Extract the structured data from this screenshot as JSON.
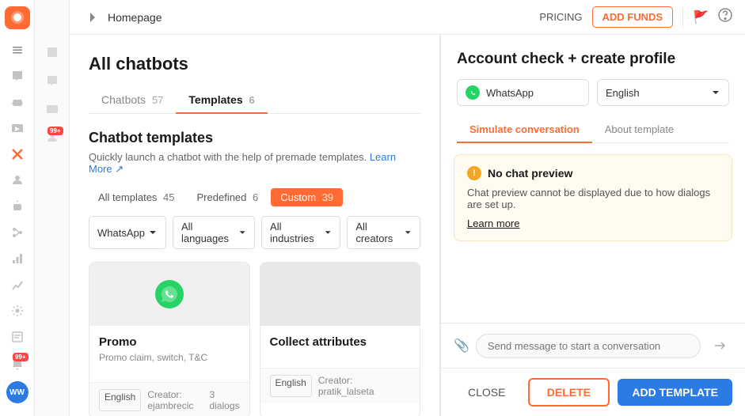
{
  "sidebar": {
    "logo": "🤖",
    "avatar": "WW",
    "items": [
      {
        "name": "home",
        "icon": "⊞",
        "active": false
      },
      {
        "name": "chat",
        "icon": "💬",
        "active": false
      },
      {
        "name": "inbox",
        "icon": "📥",
        "active": false
      },
      {
        "name": "media",
        "icon": "🖼",
        "active": false
      },
      {
        "name": "integrations",
        "icon": "✕",
        "active": true,
        "badge": "99+"
      },
      {
        "name": "contacts",
        "icon": "👥",
        "active": false
      },
      {
        "name": "bots",
        "icon": "🤖",
        "active": false
      },
      {
        "name": "flows",
        "icon": "⟲",
        "active": false
      },
      {
        "name": "analytics",
        "icon": "📊",
        "active": false
      },
      {
        "name": "reports",
        "icon": "📈",
        "active": false
      },
      {
        "name": "settings",
        "icon": "⚙",
        "active": false
      },
      {
        "name": "logs",
        "icon": "📋",
        "active": false
      },
      {
        "name": "notifications",
        "icon": "🔔",
        "active": false,
        "badge": "99+"
      }
    ]
  },
  "topbar": {
    "breadcrumb": "Homepage",
    "pricing_label": "PRICING",
    "add_funds_label": "ADD FUNDS"
  },
  "main": {
    "page_title": "All chatbots",
    "tabs": [
      {
        "label": "Chatbots",
        "count": "57",
        "active": false
      },
      {
        "label": "Templates",
        "count": "6",
        "active": true
      }
    ],
    "section_title": "Chatbot templates",
    "section_desc": "Quickly launch a chatbot with the help of premade templates.",
    "learn_more": "Learn More",
    "filter_tabs": [
      {
        "label": "All templates",
        "count": "45",
        "active": false
      },
      {
        "label": "Predefined",
        "count": "6",
        "active": false
      },
      {
        "label": "Custom",
        "count": "39",
        "active": true
      }
    ],
    "dropdowns": [
      {
        "label": "WhatsApp"
      },
      {
        "label": "All languages"
      },
      {
        "label": "All industries"
      },
      {
        "label": "All creators"
      }
    ],
    "cards": [
      {
        "name": "Promo",
        "desc": "Promo claim, switch, T&C",
        "language": "English",
        "creator": "Creator: ejambrecic",
        "dialogs": "3 dialogs",
        "has_icon": true
      },
      {
        "name": "Collect attributes",
        "desc": "",
        "language": "English",
        "creator": "Creator: pratik_lalseta",
        "dialogs": "",
        "has_icon": false
      }
    ]
  },
  "right_panel": {
    "title": "Account check + create profile",
    "channel_label": "WhatsApp",
    "lang_label": "English",
    "tabs": [
      {
        "label": "Simulate conversation",
        "active": true
      },
      {
        "label": "About template",
        "active": false
      }
    ],
    "no_preview_title": "No chat preview",
    "no_preview_text": "Chat preview cannot be displayed due to how dialogs are set up.",
    "learn_more_label": "Learn more",
    "chat_placeholder": "Send message to start a conversation",
    "actions": {
      "close_label": "CLOSE",
      "delete_label": "DELETE",
      "add_template_label": "ADD TEMPLATE"
    }
  }
}
